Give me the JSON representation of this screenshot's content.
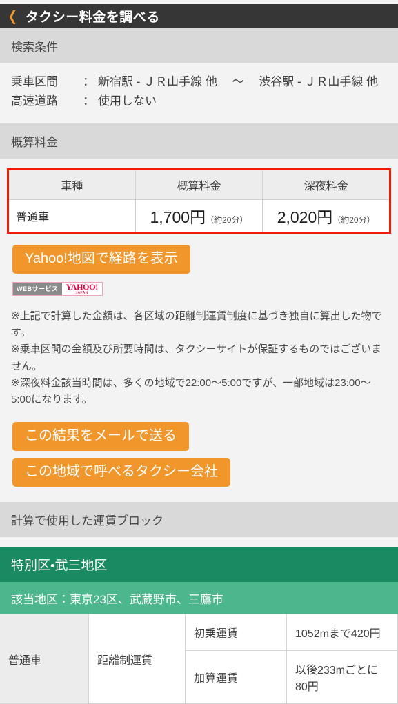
{
  "header": {
    "back_icon": "chevron-left-icon",
    "title": "タクシー料金を調べる"
  },
  "sections": {
    "search_conditions_title": "検索条件",
    "estimated_fare_title": "概算料金",
    "fare_block_title": "計算で使用した運賃ブロック"
  },
  "conditions": [
    {
      "label": "乗車区間",
      "colon": "：",
      "value": "新宿駅 - ＪＲ山手線 他 　〜　 渋谷駅 - ＪＲ山手線 他"
    },
    {
      "label": "高速道路",
      "colon": "：",
      "value": "使用しない"
    }
  ],
  "fare_table": {
    "headers": [
      "車種",
      "概算料金",
      "深夜料金"
    ],
    "rows": [
      {
        "kind": "普通車",
        "estimated_amount": "1,700円",
        "estimated_note": "（約20分）",
        "late_night_amount": "2,020円",
        "late_night_note": "（約20分）"
      }
    ],
    "highlight_color": "#f51b00"
  },
  "buttons": {
    "map_route": "Yahoo!地図で経路を表示",
    "mail_result": "この結果をメールで送る",
    "taxi_companies": "この地域で呼べるタクシー会社",
    "accent_color": "#f0962a"
  },
  "yahoo_badge": {
    "left_label": "WEBサービス",
    "brand": "YAHOO!",
    "brand_sub": "JAPAN"
  },
  "notes": [
    "※上記で計算した金額は、各区域の距離制運賃制度に基づき独自に算出した物です。",
    "※乗車区間の金額及び所要時間は、タクシーサイトが保証するものではございません。",
    "※深夜料金該当時間は、多くの地域で22:00〜5:00ですが、一部地域は23:00〜5:00になります。"
  ],
  "fare_block": {
    "area_name": "特別区・武三地区",
    "applicable_areas": "該当地区：東京23区、武蔵野市、三鷹市",
    "header_color": "#1a8a62",
    "sub_color": "#4cb68c",
    "rows": [
      {
        "vehicle": "普通車",
        "fare_type": "距離制運賃",
        "items": [
          {
            "name": "初乗運賃",
            "value": "1052mまで420円"
          },
          {
            "name": "加算運賃",
            "value": "以後233mごとに80円"
          }
        ]
      }
    ]
  }
}
